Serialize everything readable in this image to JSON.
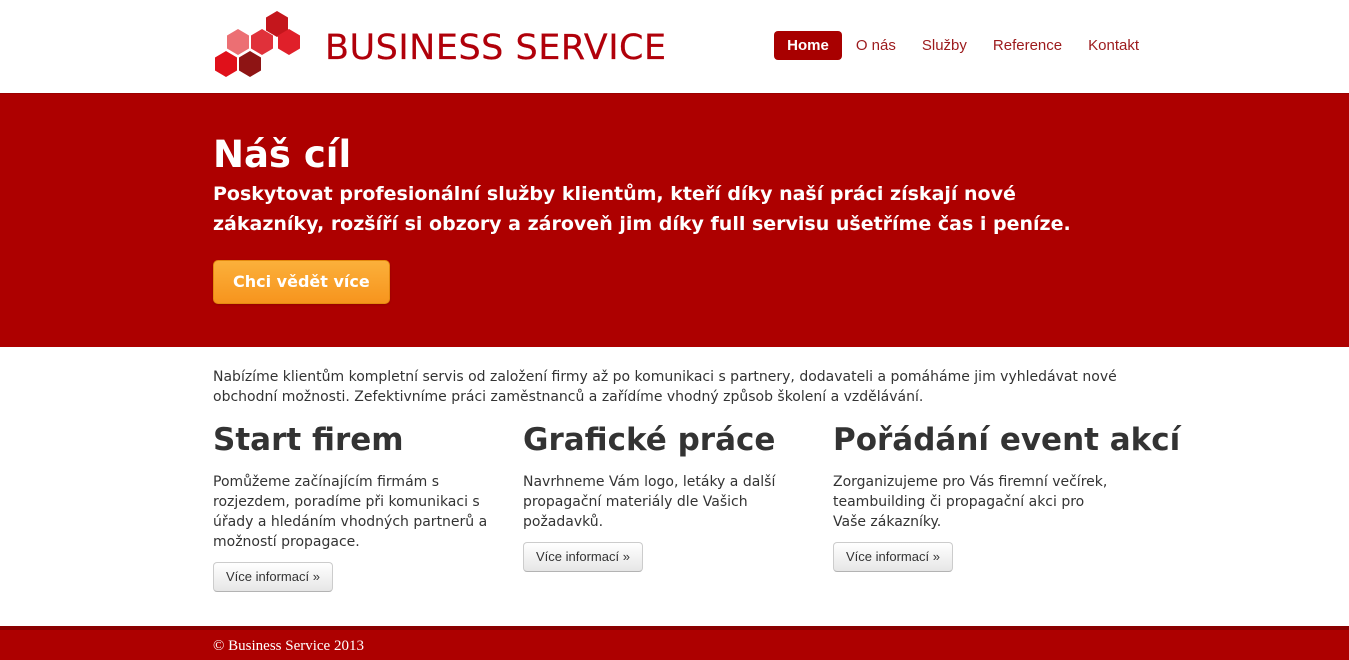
{
  "brand": {
    "name": "BUSINESS SERVICE",
    "color": "#b0000a",
    "logo_icon": "hexagon-cluster-icon"
  },
  "nav": {
    "items": [
      {
        "label": "Home",
        "active": true
      },
      {
        "label": "O nás",
        "active": false
      },
      {
        "label": "Služby",
        "active": false
      },
      {
        "label": "Reference",
        "active": false
      },
      {
        "label": "Kontakt",
        "active": false
      }
    ]
  },
  "hero": {
    "title": "Náš cíl",
    "text": "Poskytovat profesionální služby klientům, kteří díky naší práci získají nové zákazníky, rozšíří si obzory a zároveň jim díky full servisu ušetříme čas i peníze.",
    "button": "Chci vědět více",
    "background": "#ad0000",
    "button_color": "#f7941d"
  },
  "main": {
    "intro": "Nabízíme klientům kompletní servis od založení firmy až po komunikaci s partnery, dodavateli a pomáháme jim vyhledávat nové obchodní možnosti. Zefektivníme práci zaměstnanců a zařídíme vhodný způsob školení a vzdělávání.",
    "columns": [
      {
        "title": "Start firem",
        "text": "Pomůžeme začínajícím firmám s rozjezdem, poradíme při komunikaci s úřady a hledáním vhodných partnerů a možností propagace.",
        "button": "Více informací »"
      },
      {
        "title": "Grafické práce",
        "text": "Navrhneme Vám logo, letáky a další propagační materiály dle Vašich požadavků.",
        "button": "Více informací »"
      },
      {
        "title": "Pořádání event akcí",
        "text": "Zorganizujeme pro Vás firemní večírek, teambuilding či propagační akci pro Vaše zákazníky.",
        "button": "Více informací »"
      }
    ]
  },
  "footer": {
    "text": "© Business Service 2013"
  }
}
